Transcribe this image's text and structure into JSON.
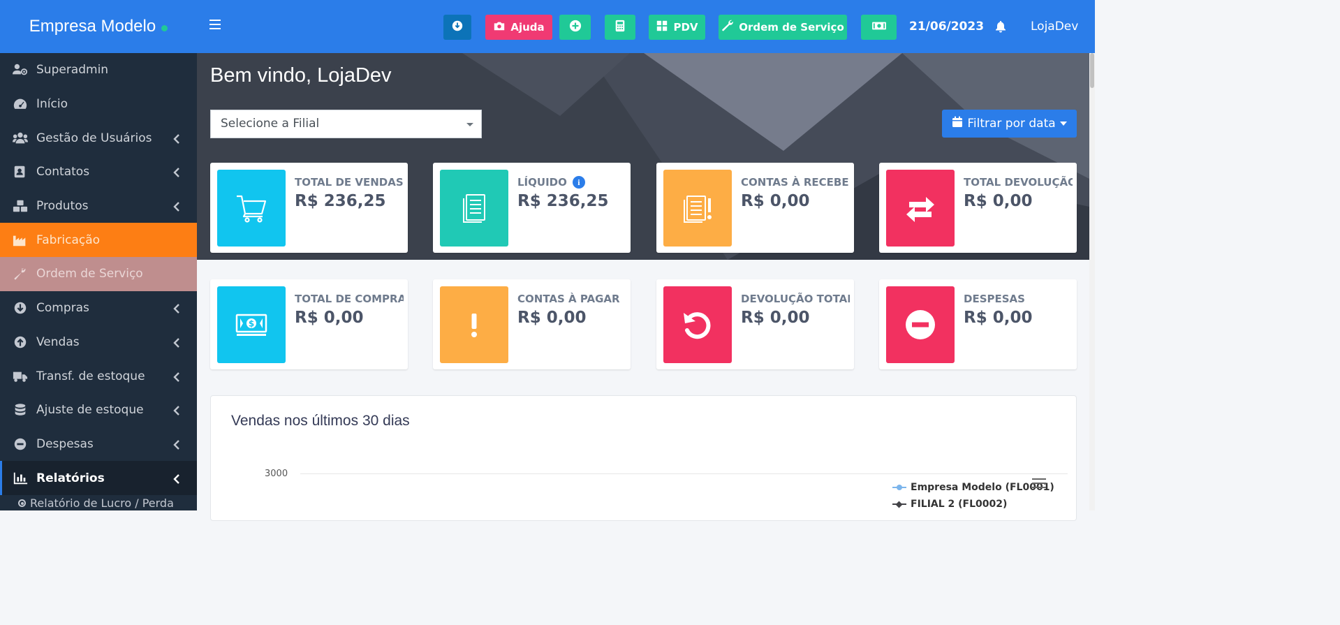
{
  "brand": {
    "name": "Empresa Modelo",
    "status_color": "#20c997"
  },
  "sidebar": {
    "items": [
      {
        "label": "Superadmin",
        "icon": "users-cog-icon"
      },
      {
        "label": "Início",
        "icon": "tachometer-icon"
      },
      {
        "label": "Gestão de Usuários",
        "icon": "users-icon"
      },
      {
        "label": "Contatos",
        "icon": "address-book-icon"
      },
      {
        "label": "Produtos",
        "icon": "cubes-icon"
      },
      {
        "label": "Fabricação",
        "icon": "industry-icon"
      },
      {
        "label": "Ordem de Serviço",
        "icon": "wrench-icon"
      },
      {
        "label": "Compras",
        "icon": "arrow-circle-down-icon"
      },
      {
        "label": "Vendas",
        "icon": "arrow-circle-up-icon"
      },
      {
        "label": "Transf. de estoque",
        "icon": "truck-icon"
      },
      {
        "label": "Ajuste de estoque",
        "icon": "database-icon"
      },
      {
        "label": "Despesas",
        "icon": "minus-circle-icon"
      },
      {
        "label": "Relatórios",
        "icon": "chart-bar-icon"
      }
    ],
    "sub_items": [
      {
        "label": "Relatório de Lucro / Perda"
      }
    ]
  },
  "navbar": {
    "help_label": "Ajuda",
    "pdv_label": "PDV",
    "service_order_label": "Ordem de Serviço",
    "date": "21/06/2023",
    "user": "LojaDev",
    "colors": {
      "primary": "#2b7de9",
      "help": "#f03a73",
      "teal": "#20c997",
      "download": "#0c73b8"
    }
  },
  "main": {
    "welcome": "Bem vindo, LojaDev",
    "branch_select_placeholder": "Selecione a Filial",
    "filter_label": "Filtrar por data",
    "cards": [
      {
        "label": "TOTAL DE VENDAS",
        "value": "R$ 236,25",
        "icon": "cart-icon",
        "color": "#11c5ef"
      },
      {
        "label": "LÍQUIDO",
        "value": "R$ 236,25",
        "icon": "document-icon",
        "color": "#20c9b5"
      },
      {
        "label": "CONTAS À RECEBER",
        "value": "R$ 0,00",
        "icon": "document-alert-icon",
        "color": "#fdad45"
      },
      {
        "label": "TOTAL DEVOLUÇÃO",
        "value": "R$ 0,00",
        "icon": "exchange-icon",
        "color": "#f23160"
      },
      {
        "label": "TOTAL DE COMPRAS",
        "value": "R$ 0,00",
        "icon": "money-icon",
        "color": "#11c5ef"
      },
      {
        "label": "CONTAS À PAGAR",
        "value": "R$ 0,00",
        "icon": "exclamation-icon",
        "color": "#fdad45"
      },
      {
        "label": "DEVOLUÇÃO TOTAL",
        "value": "R$ 0,00",
        "icon": "undo-icon",
        "color": "#f23160"
      },
      {
        "label": "DESPESAS",
        "value": "R$ 0,00",
        "icon": "minus-circle-icon",
        "color": "#f23160"
      }
    ],
    "chart_panel": {
      "title": "Vendas nos últimos 30 dias",
      "y_tick": "3000",
      "legend": [
        {
          "name": "Empresa Modelo (FL0001)",
          "color": "#7cb5ec"
        },
        {
          "name": "FILIAL 2 (FL0002)",
          "color": "#434348"
        }
      ]
    }
  },
  "chart_data": {
    "type": "line",
    "title": "Vendas nos últimos 30 dias",
    "series": [
      {
        "name": "Empresa Modelo (FL0001)",
        "values": []
      },
      {
        "name": "FILIAL 2 (FL0002)",
        "values": []
      }
    ],
    "y_ticks_visible": [
      3000
    ]
  }
}
